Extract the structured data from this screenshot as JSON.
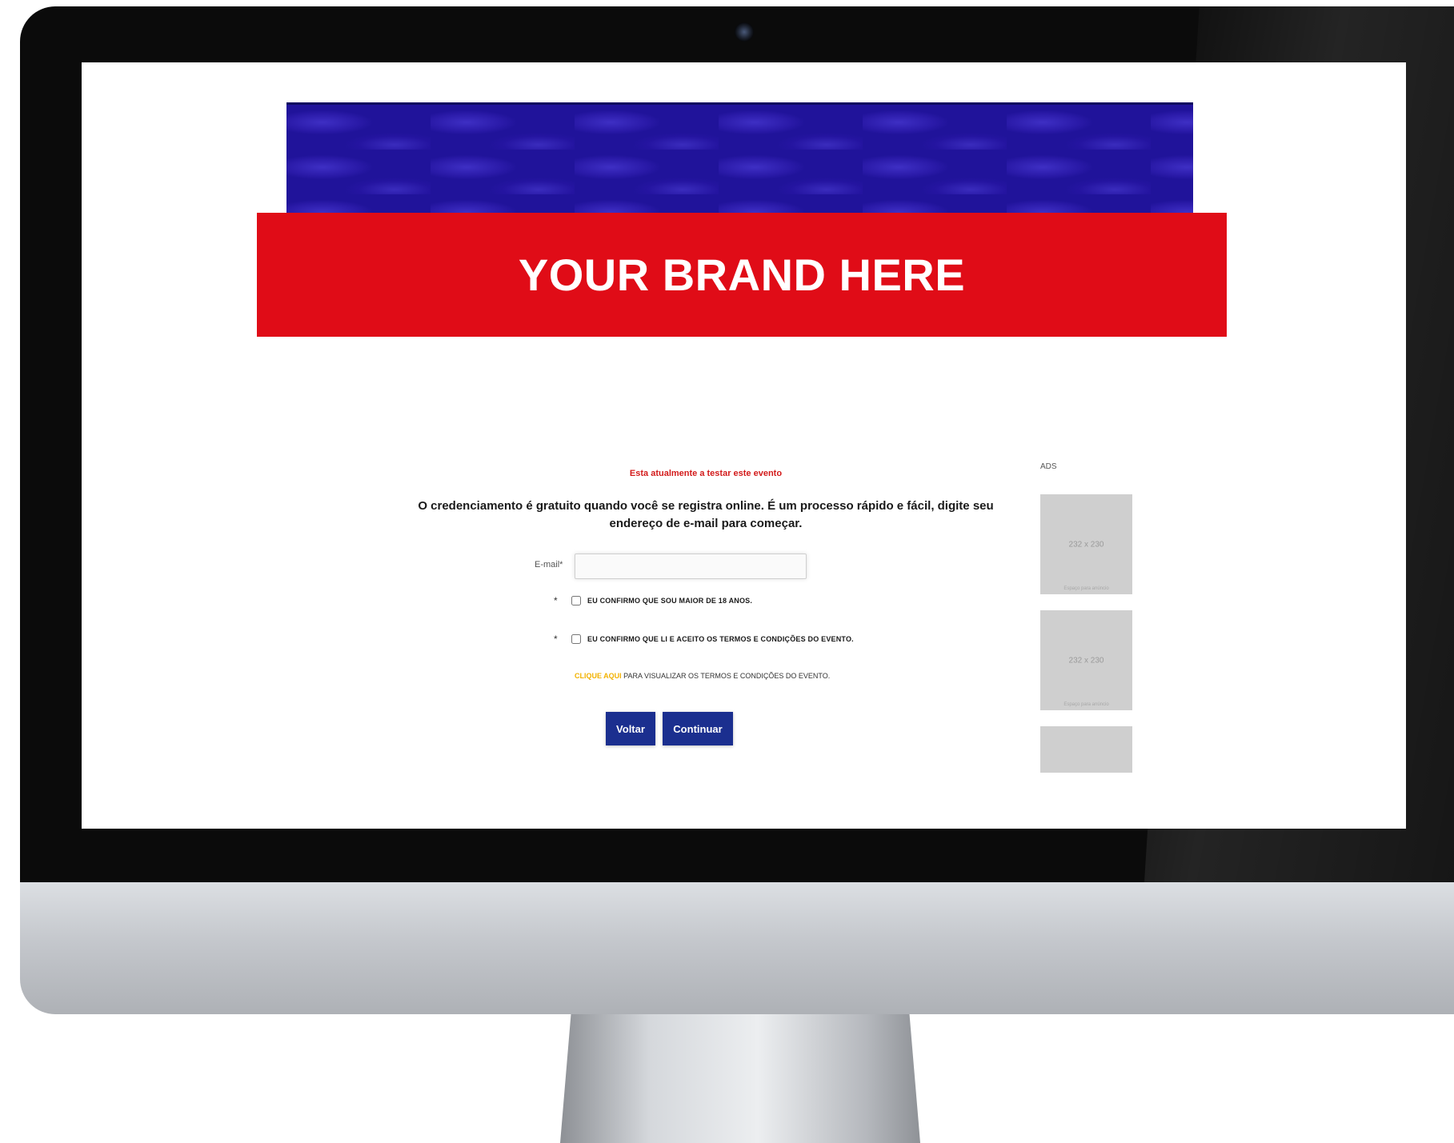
{
  "brand": {
    "text": "YOUR BRAND HERE",
    "color": "#e00c17"
  },
  "form": {
    "alert": "Esta atualmente a testar este evento",
    "intro": "O credenciamento é gratuito quando você se registra online. É um processo rápido e fácil, digite seu endereço de e-mail para começar.",
    "email_label": "E-mail*",
    "email_value": "",
    "checkbox_age": {
      "required_mark": "*",
      "label": "EU CONFIRMO QUE SOU MAIOR DE 18 ANOS."
    },
    "checkbox_terms": {
      "required_mark": "*",
      "label": "EU CONFIRMO QUE LI E ACEITO OS TERMOS E CONDIÇÕES DO EVENTO."
    },
    "terms_link": "CLIQUE AQUI",
    "terms_text": " PARA VISUALIZAR OS TERMOS E CONDIÇÕES DO EVENTO.",
    "back_button": "Voltar",
    "continue_button": "Continuar"
  },
  "ads": {
    "label": "ADS",
    "boxes": [
      {
        "size": "232 x 230",
        "caption": "Espaço para anúncio"
      },
      {
        "size": "232 x 230",
        "caption": "Espaço para anúncio"
      }
    ]
  }
}
